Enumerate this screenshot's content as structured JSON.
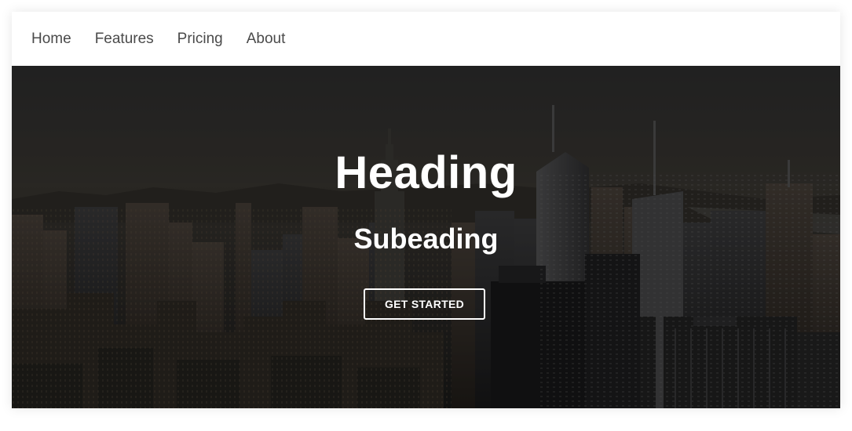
{
  "nav": {
    "items": [
      {
        "label": "Home"
      },
      {
        "label": "Features"
      },
      {
        "label": "Pricing"
      },
      {
        "label": "About"
      }
    ]
  },
  "hero": {
    "heading": "Heading",
    "subheading": "Subeading",
    "button_label": "GET STARTED",
    "background": "city-skyline-photo",
    "overlay_color": "#000000"
  },
  "colors": {
    "nav_background": "#ffffff",
    "nav_text": "#4a4a4a",
    "hero_text": "#ffffff"
  }
}
